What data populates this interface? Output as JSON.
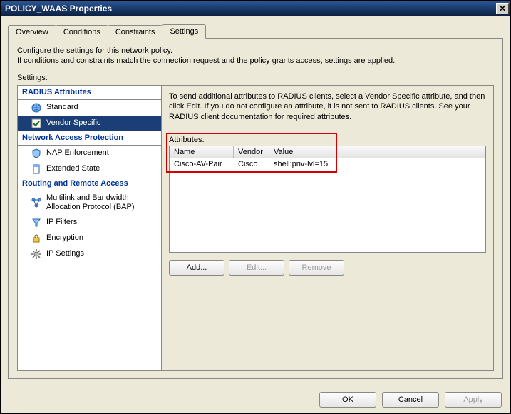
{
  "window": {
    "title": "POLICY_WAAS Properties"
  },
  "tabs": {
    "overview": "Overview",
    "conditions": "Conditions",
    "constraints": "Constraints",
    "settings": "Settings"
  },
  "instructions": {
    "line1": "Configure the settings for this network policy.",
    "line2": "If conditions and constraints match the connection request and the policy grants access, settings are applied."
  },
  "settings_label": "Settings:",
  "sidebar": {
    "groups": [
      {
        "title": "RADIUS Attributes",
        "items": [
          {
            "icon": "globe",
            "label": "Standard",
            "selected": false
          },
          {
            "icon": "check",
            "label": "Vendor Specific",
            "selected": true
          }
        ]
      },
      {
        "title": "Network Access Protection",
        "items": [
          {
            "icon": "shield",
            "label": "NAP Enforcement",
            "selected": false
          },
          {
            "icon": "doc",
            "label": "Extended State",
            "selected": false
          }
        ]
      },
      {
        "title": "Routing and Remote Access",
        "items": [
          {
            "icon": "net",
            "label": "Multilink and Bandwidth Allocation Protocol (BAP)",
            "selected": false
          },
          {
            "icon": "funnel",
            "label": "IP Filters",
            "selected": false
          },
          {
            "icon": "lock",
            "label": "Encryption",
            "selected": false
          },
          {
            "icon": "gear",
            "label": "IP Settings",
            "selected": false
          }
        ]
      }
    ]
  },
  "right": {
    "description": "To send additional attributes to RADIUS clients, select a Vendor Specific attribute, and then click Edit. If you do not configure an attribute, it is not sent to RADIUS clients. See your RADIUS client documentation for required attributes.",
    "attributes_label": "Attributes:",
    "columns": {
      "name": "Name",
      "vendor": "Vendor",
      "value": "Value"
    },
    "rows": [
      {
        "name": "Cisco-AV-Pair",
        "vendor": "Cisco",
        "value": "shell:priv-lvl=15"
      }
    ],
    "buttons": {
      "add": "Add...",
      "edit": "Edit...",
      "remove": "Remove"
    }
  },
  "footer": {
    "ok": "OK",
    "cancel": "Cancel",
    "apply": "Apply"
  }
}
